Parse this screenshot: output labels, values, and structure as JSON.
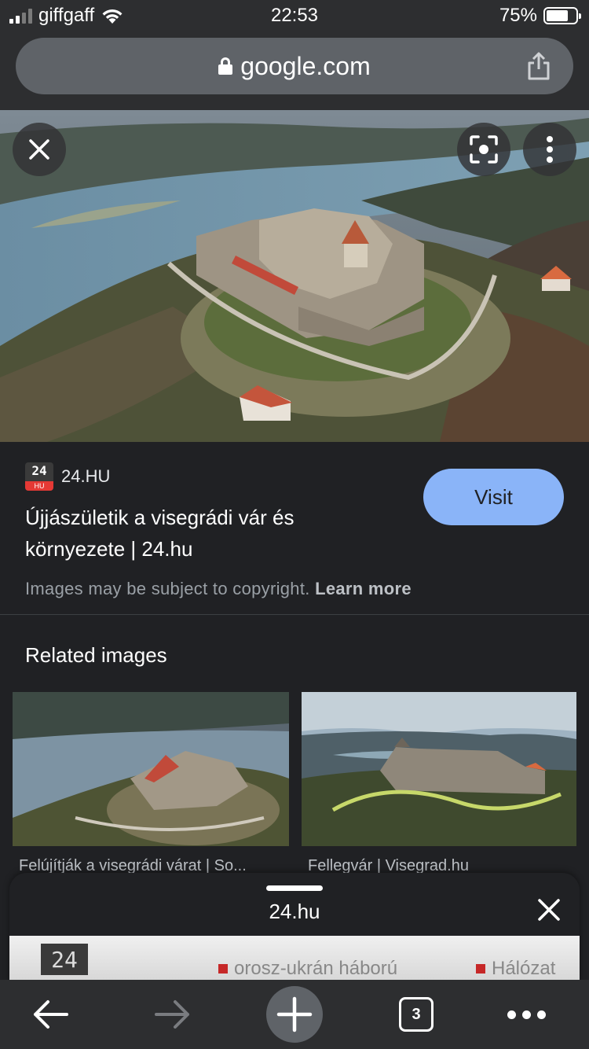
{
  "status_bar": {
    "carrier": "giffgaff",
    "time": "22:53",
    "battery": "75%",
    "battery_level": 0.75
  },
  "address_bar": {
    "url": "google.com"
  },
  "result": {
    "source_name": "24.HU",
    "favicon_text": "24",
    "favicon_sub": "HU",
    "title": "Újjászületik a visegrádi vár és környezete | 24.hu",
    "visit_label": "Visit",
    "copyright_text": "Images may be subject to copyright.",
    "learn_more": "Learn more"
  },
  "related": {
    "heading": "Related images",
    "items": [
      {
        "caption": "Felújítják a visegrádi várat | So..."
      },
      {
        "caption": "Fellegvár | Visegrad.hu"
      }
    ]
  },
  "sheet": {
    "title": "24.hu",
    "preview_logo": "24",
    "preview_links": [
      "orosz-ukrán háború",
      "Hálózat"
    ]
  },
  "toolbar": {
    "tab_count": "3"
  },
  "colors": {
    "accent": "#8ab4f8",
    "background": "#202124",
    "toolbar": "#2d2e30",
    "pill": "#5f6368"
  }
}
